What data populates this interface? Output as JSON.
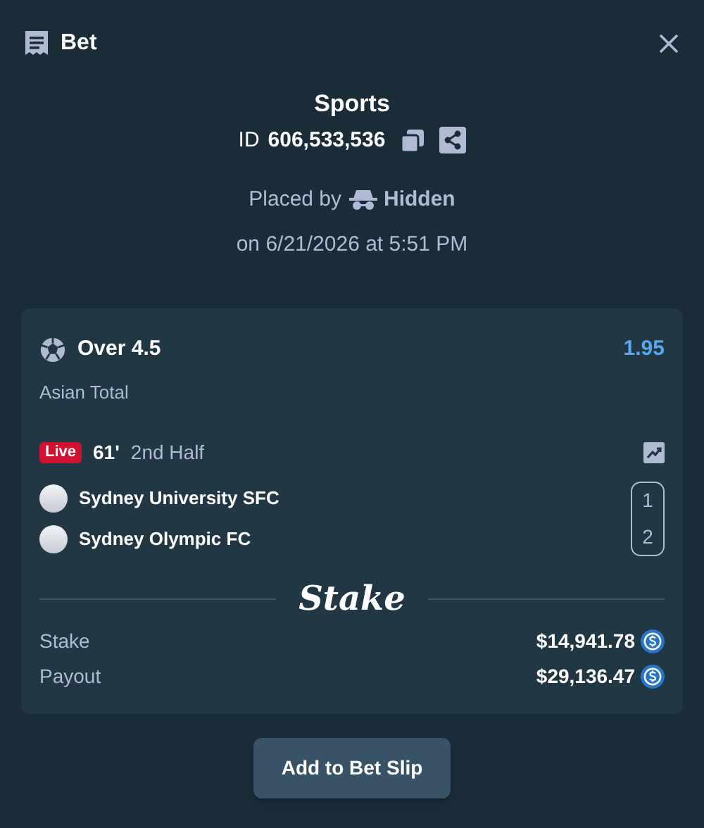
{
  "header": {
    "title": "Bet"
  },
  "summary": {
    "category": "Sports",
    "id_label": "ID",
    "id_value": "606,533,536",
    "placed_by_label": "Placed by",
    "user": "Hidden",
    "placed_on": "on 6/21/2026 at 5:51 PM"
  },
  "bet": {
    "selection": "Over 4.5",
    "odds": "1.95",
    "market": "Asian Total",
    "live_badge": "Live",
    "minute": "61'",
    "period": "2nd Half",
    "teams": [
      {
        "name": "Sydney University SFC",
        "score": "1"
      },
      {
        "name": "Sydney Olympic FC",
        "score": "2"
      }
    ],
    "brand": "Stake",
    "amounts": [
      {
        "label": "Stake",
        "value": "$14,941.78"
      },
      {
        "label": "Payout",
        "value": "$29,136.47"
      }
    ]
  },
  "action": {
    "label": "Add to Bet Slip"
  }
}
